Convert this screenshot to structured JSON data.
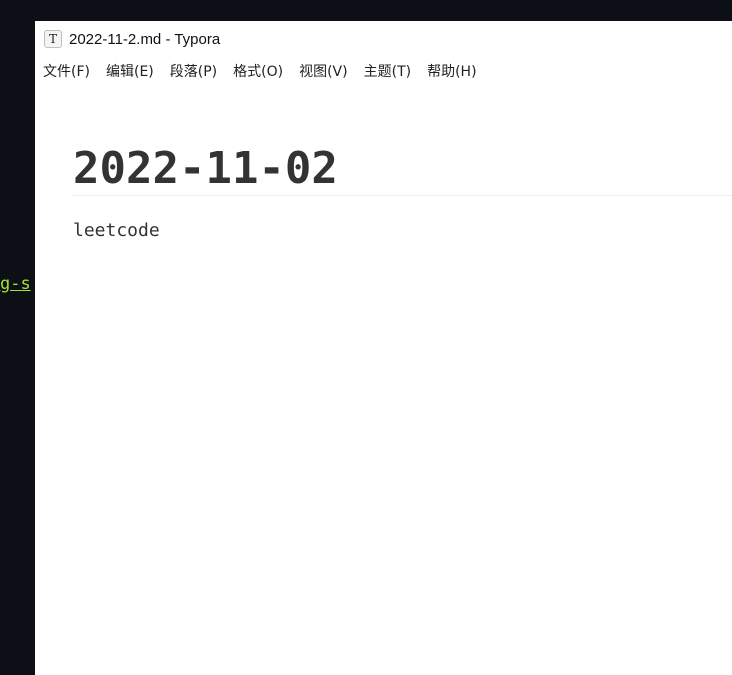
{
  "background": {
    "terminal_text": "g-s",
    "terminal_text_color": "#a6e22e",
    "terminal_bg_color": "#0c0f15"
  },
  "window": {
    "icon_glyph": "T",
    "icon_name": "typora-app-icon",
    "title": "2022-11-2.md - Typora"
  },
  "menubar": {
    "items": [
      {
        "label": "文件(F)"
      },
      {
        "label": "编辑(E)"
      },
      {
        "label": "段落(P)"
      },
      {
        "label": "格式(O)"
      },
      {
        "label": "视图(V)"
      },
      {
        "label": "主题(T)"
      },
      {
        "label": "帮助(H)"
      }
    ]
  },
  "document": {
    "heading": "2022-11-02",
    "paragraph": "leetcode"
  }
}
